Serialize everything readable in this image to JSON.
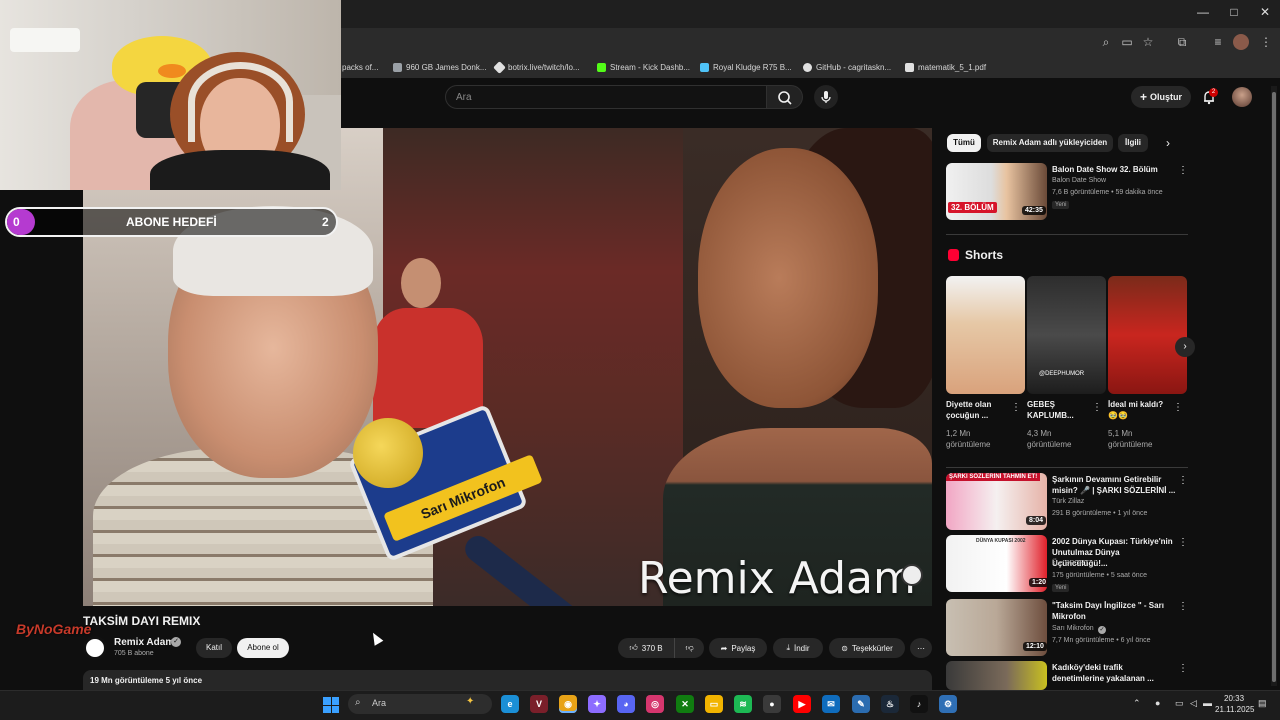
{
  "browser": {
    "window_controls": [
      "—",
      "□",
      "✕"
    ],
    "bookmarks": [
      {
        "label": "packs of...",
        "icon": "folder-icon",
        "color": ""
      },
      {
        "label": "960 GB James Donk...",
        "icon": "folder-icon",
        "color": "#9aa0a6"
      },
      {
        "label": "botrix.live/twitch/lo...",
        "icon": "diamond-icon",
        "color": "#e0e0e0"
      },
      {
        "label": "Stream - Kick Dashb...",
        "icon": "kick-icon",
        "color": "#53fc18"
      },
      {
        "label": "Royal Kludge R75 B...",
        "icon": "gem-icon",
        "color": "#4fc3f7"
      },
      {
        "label": "GitHub - cagritaskn...",
        "icon": "github-icon",
        "color": "#e0e0e0"
      },
      {
        "label": "matematik_5_1.pdf",
        "icon": "file-icon",
        "color": "#e0e0e0"
      }
    ]
  },
  "youtube_header": {
    "search_placeholder": "Ara",
    "create_label": "Oluştur",
    "notification_count": "2"
  },
  "overlay": {
    "sub_goal_label": "ABONE HEDEFİ",
    "sub_goal_start": "0",
    "sub_goal_end": "2",
    "streamer_logo": "ByNoGame"
  },
  "video": {
    "watermark_text": "Remix Adam",
    "mic_text": "Sarı Mikrofon",
    "title": "TAKSİM DAYI REMIX",
    "channel_name": "Remix Adam",
    "channel_subs": "705 B abone",
    "join_label": "Katıl",
    "subscribe_label": "Abone ol",
    "like_count": "370 B",
    "share_label": "Paylaş",
    "download_label": "İndir",
    "thanks_label": "Teşekkürler",
    "stats": "19 Mn görüntüleme  5 yıl önce"
  },
  "sidebar": {
    "chips": [
      "Tümü",
      "Remix Adam adlı yükleyiciden",
      "İlgili"
    ],
    "top_rec": {
      "title": "Balon Date Show 32. Bölüm",
      "channel": "Balon Date Show",
      "meta": "7,6 B görüntüleme • 59 dakika önce",
      "badge": "Yeni",
      "duration": "42:35",
      "thumb_text": "32. BÖLÜM"
    },
    "shorts_title": "Shorts",
    "shorts": [
      {
        "title": "Diyette olan çocuğun ...",
        "views": "1,2 Mn görüntüleme"
      },
      {
        "title": "GEBEŞ KAPLUMB...",
        "views": "4,3 Mn görüntüleme",
        "thumb_text": "@DEEPHUMOR"
      },
      {
        "title": "İdeal mi kaldı? 🥹🥹",
        "views": "5,1 Mn görüntüleme"
      }
    ],
    "recs": [
      {
        "title": "Şarkının Devamını Getirebilir misin? 🎤 | ŞARKI SÖZLERİNİ ...",
        "channel": "Türk Zillaz",
        "meta": "291 B görüntüleme • 1 yıl önce",
        "badge": "",
        "duration": "8:04",
        "thumb_text": "ŞARKI SÖZLERİNİ TAHMİN ET!"
      },
      {
        "title": "2002 Dünya Kupası: Türkiye'nin Unutulmaz Dünya Üçüncülüğü!...",
        "channel": "kLc SPORT",
        "meta": "175 görüntüleme • 5 saat önce",
        "badge": "Yeni",
        "duration": "1:20",
        "thumb_text": "DÜNYA KUPASI 2002"
      },
      {
        "title": "\"Taksim Dayı İngilizce \" - Sarı Mikrofon",
        "channel": "Sarı Mikrofon",
        "meta": "7,7 Mn görüntüleme • 6 yıl önce",
        "badge": "",
        "duration": "12:10",
        "thumb_text": ""
      },
      {
        "title": "Kadıköy'deki trafik denetimlerine yakalanan ...",
        "channel": "",
        "meta": "",
        "badge": "",
        "duration": "",
        "thumb_text": ""
      }
    ]
  },
  "taskbar": {
    "search_placeholder": "Ara",
    "time": "20:33",
    "date": "21.11.2025",
    "apps": [
      {
        "name": "edge-icon",
        "glyph": "e",
        "color": "#1b8fd6"
      },
      {
        "name": "app-v-icon",
        "glyph": "V",
        "color": "#7a1f2a"
      },
      {
        "name": "chrome-icon",
        "glyph": "◉",
        "color": "#e8a317"
      },
      {
        "name": "copilot-icon",
        "glyph": "✦",
        "color": "#8d6cff"
      },
      {
        "name": "discord-icon",
        "glyph": "◕",
        "color": "#5865f2"
      },
      {
        "name": "instagram-icon",
        "glyph": "◎",
        "color": "#d6366e"
      },
      {
        "name": "xbox-icon",
        "glyph": "✕",
        "color": "#107c10"
      },
      {
        "name": "file-explorer-icon",
        "glyph": "▭",
        "color": "#f2b400"
      },
      {
        "name": "spotify-icon",
        "glyph": "≋",
        "color": "#1db954"
      },
      {
        "name": "obs-icon",
        "glyph": "●",
        "color": "#3a3a3a"
      },
      {
        "name": "youtube-icon",
        "glyph": "▶",
        "color": "#ff0000"
      },
      {
        "name": "mail-icon",
        "glyph": "✉",
        "color": "#0f6cbd"
      },
      {
        "name": "notes-icon",
        "glyph": "✎",
        "color": "#2b6cb0"
      },
      {
        "name": "steam-icon",
        "glyph": "♨",
        "color": "#1b2838"
      },
      {
        "name": "tiktok-icon",
        "glyph": "♪",
        "color": "#111111"
      },
      {
        "name": "app-gear-icon",
        "glyph": "⚙",
        "color": "#2f6fb5"
      }
    ]
  }
}
